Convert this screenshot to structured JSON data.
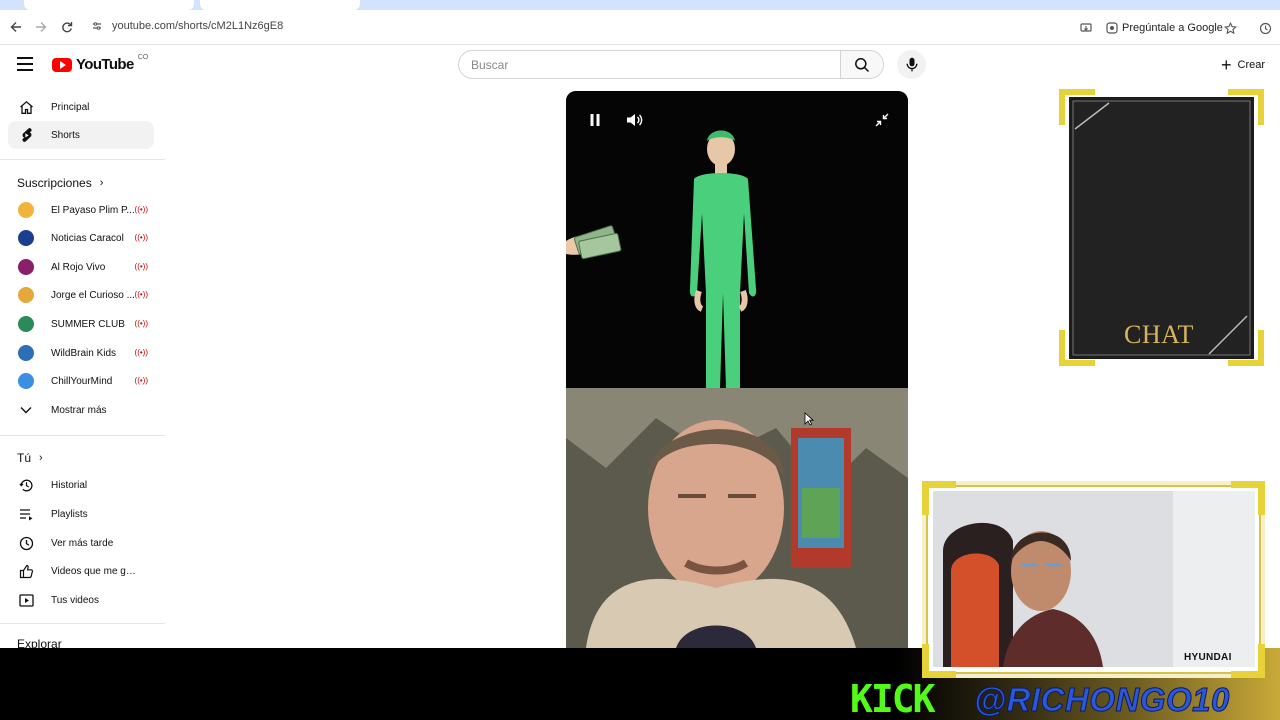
{
  "browser": {
    "url": "youtube.com/shorts/cM2L1Nz6gE8",
    "ask_google": "Pregúntale a Google"
  },
  "header": {
    "logo_text": "YouTube",
    "logo_superscript": "CO",
    "search_placeholder": "Buscar",
    "create_label": "Crear"
  },
  "sidebar": {
    "main": [
      {
        "label": "Principal",
        "icon": "home-icon"
      },
      {
        "label": "Shorts",
        "icon": "shorts-icon",
        "active": true
      }
    ],
    "subscriptions_title": "Suscripciones",
    "subscriptions": [
      {
        "label": "El Payaso Plim P...",
        "color": "#f2b33d"
      },
      {
        "label": "Noticias Caracol",
        "color": "#1a3f8f"
      },
      {
        "label": "Al Rojo Vivo",
        "color": "#8b1f6a"
      },
      {
        "label": "Jorge el Curioso ...",
        "color": "#e4a93a"
      },
      {
        "label": "SUMMER CLUB",
        "color": "#2a8a5a"
      },
      {
        "label": "WildBrain Kids",
        "color": "#2c6fb6"
      },
      {
        "label": "ChillYourMind",
        "color": "#3b8fe0"
      }
    ],
    "show_more": "Mostrar más",
    "you_title": "Tú",
    "you_items": [
      {
        "label": "Historial",
        "icon": "history-icon"
      },
      {
        "label": "Playlists",
        "icon": "playlists-icon"
      },
      {
        "label": "Ver más tarde",
        "icon": "watch-later-icon"
      },
      {
        "label": "Videos que me gus...",
        "icon": "thumbs-up-icon"
      },
      {
        "label": "Tus videos",
        "icon": "your-videos-icon"
      }
    ],
    "explore_title": "Explorar"
  },
  "overlay": {
    "chat_label": "CHAT",
    "kick_text": "KICK",
    "kick_handle": "@RICHONGO10",
    "camera_brand": "HYUNDAI",
    "kick_color": "#53fc18",
    "gold_color": "#e8d23a"
  }
}
